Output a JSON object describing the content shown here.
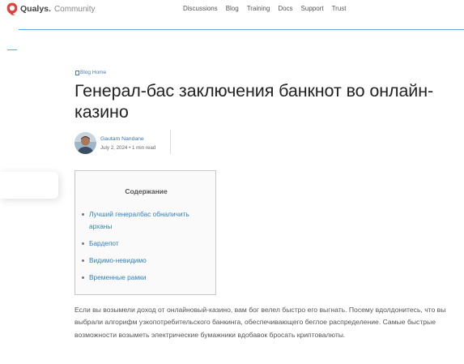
{
  "header": {
    "brand": "Qualys.",
    "brand_sub": "Community",
    "nav": [
      "Discussions",
      "Blog",
      "Training",
      "Docs",
      "Support",
      "Trust"
    ]
  },
  "breadcrumb": {
    "label": "Blog Home"
  },
  "article": {
    "title": "Генерал-бас заключения банкнот во онлайн-казино",
    "author": "Gautam Nandane",
    "meta": "July 2, 2024 • 1 min read"
  },
  "toc": {
    "title": "Содержание",
    "items": [
      "Лучший генералбас обналичить арханы",
      "Бардепот",
      "Видимо-невидимо",
      "Временные рамки"
    ]
  },
  "body": {
    "paragraph": "Если вы возымели доход от онлайновый-казино, вам бог велел быстро его выгнать. Посему вдолдонитесь, что вы выбрали алгорифм узкопотребительского банкинга, обеспечивающего беглое распределение. Самые быстрые возможности возыметь электрические бумажники вдобавок бросать криптовалюты."
  },
  "colors": {
    "accent": "#5aa9e6",
    "link": "#2f7fbf",
    "brand_red": "#e2403c"
  },
  "icons": [
    "qualys-shield-icon",
    "blog-home-icon",
    "avatar-photo"
  ]
}
